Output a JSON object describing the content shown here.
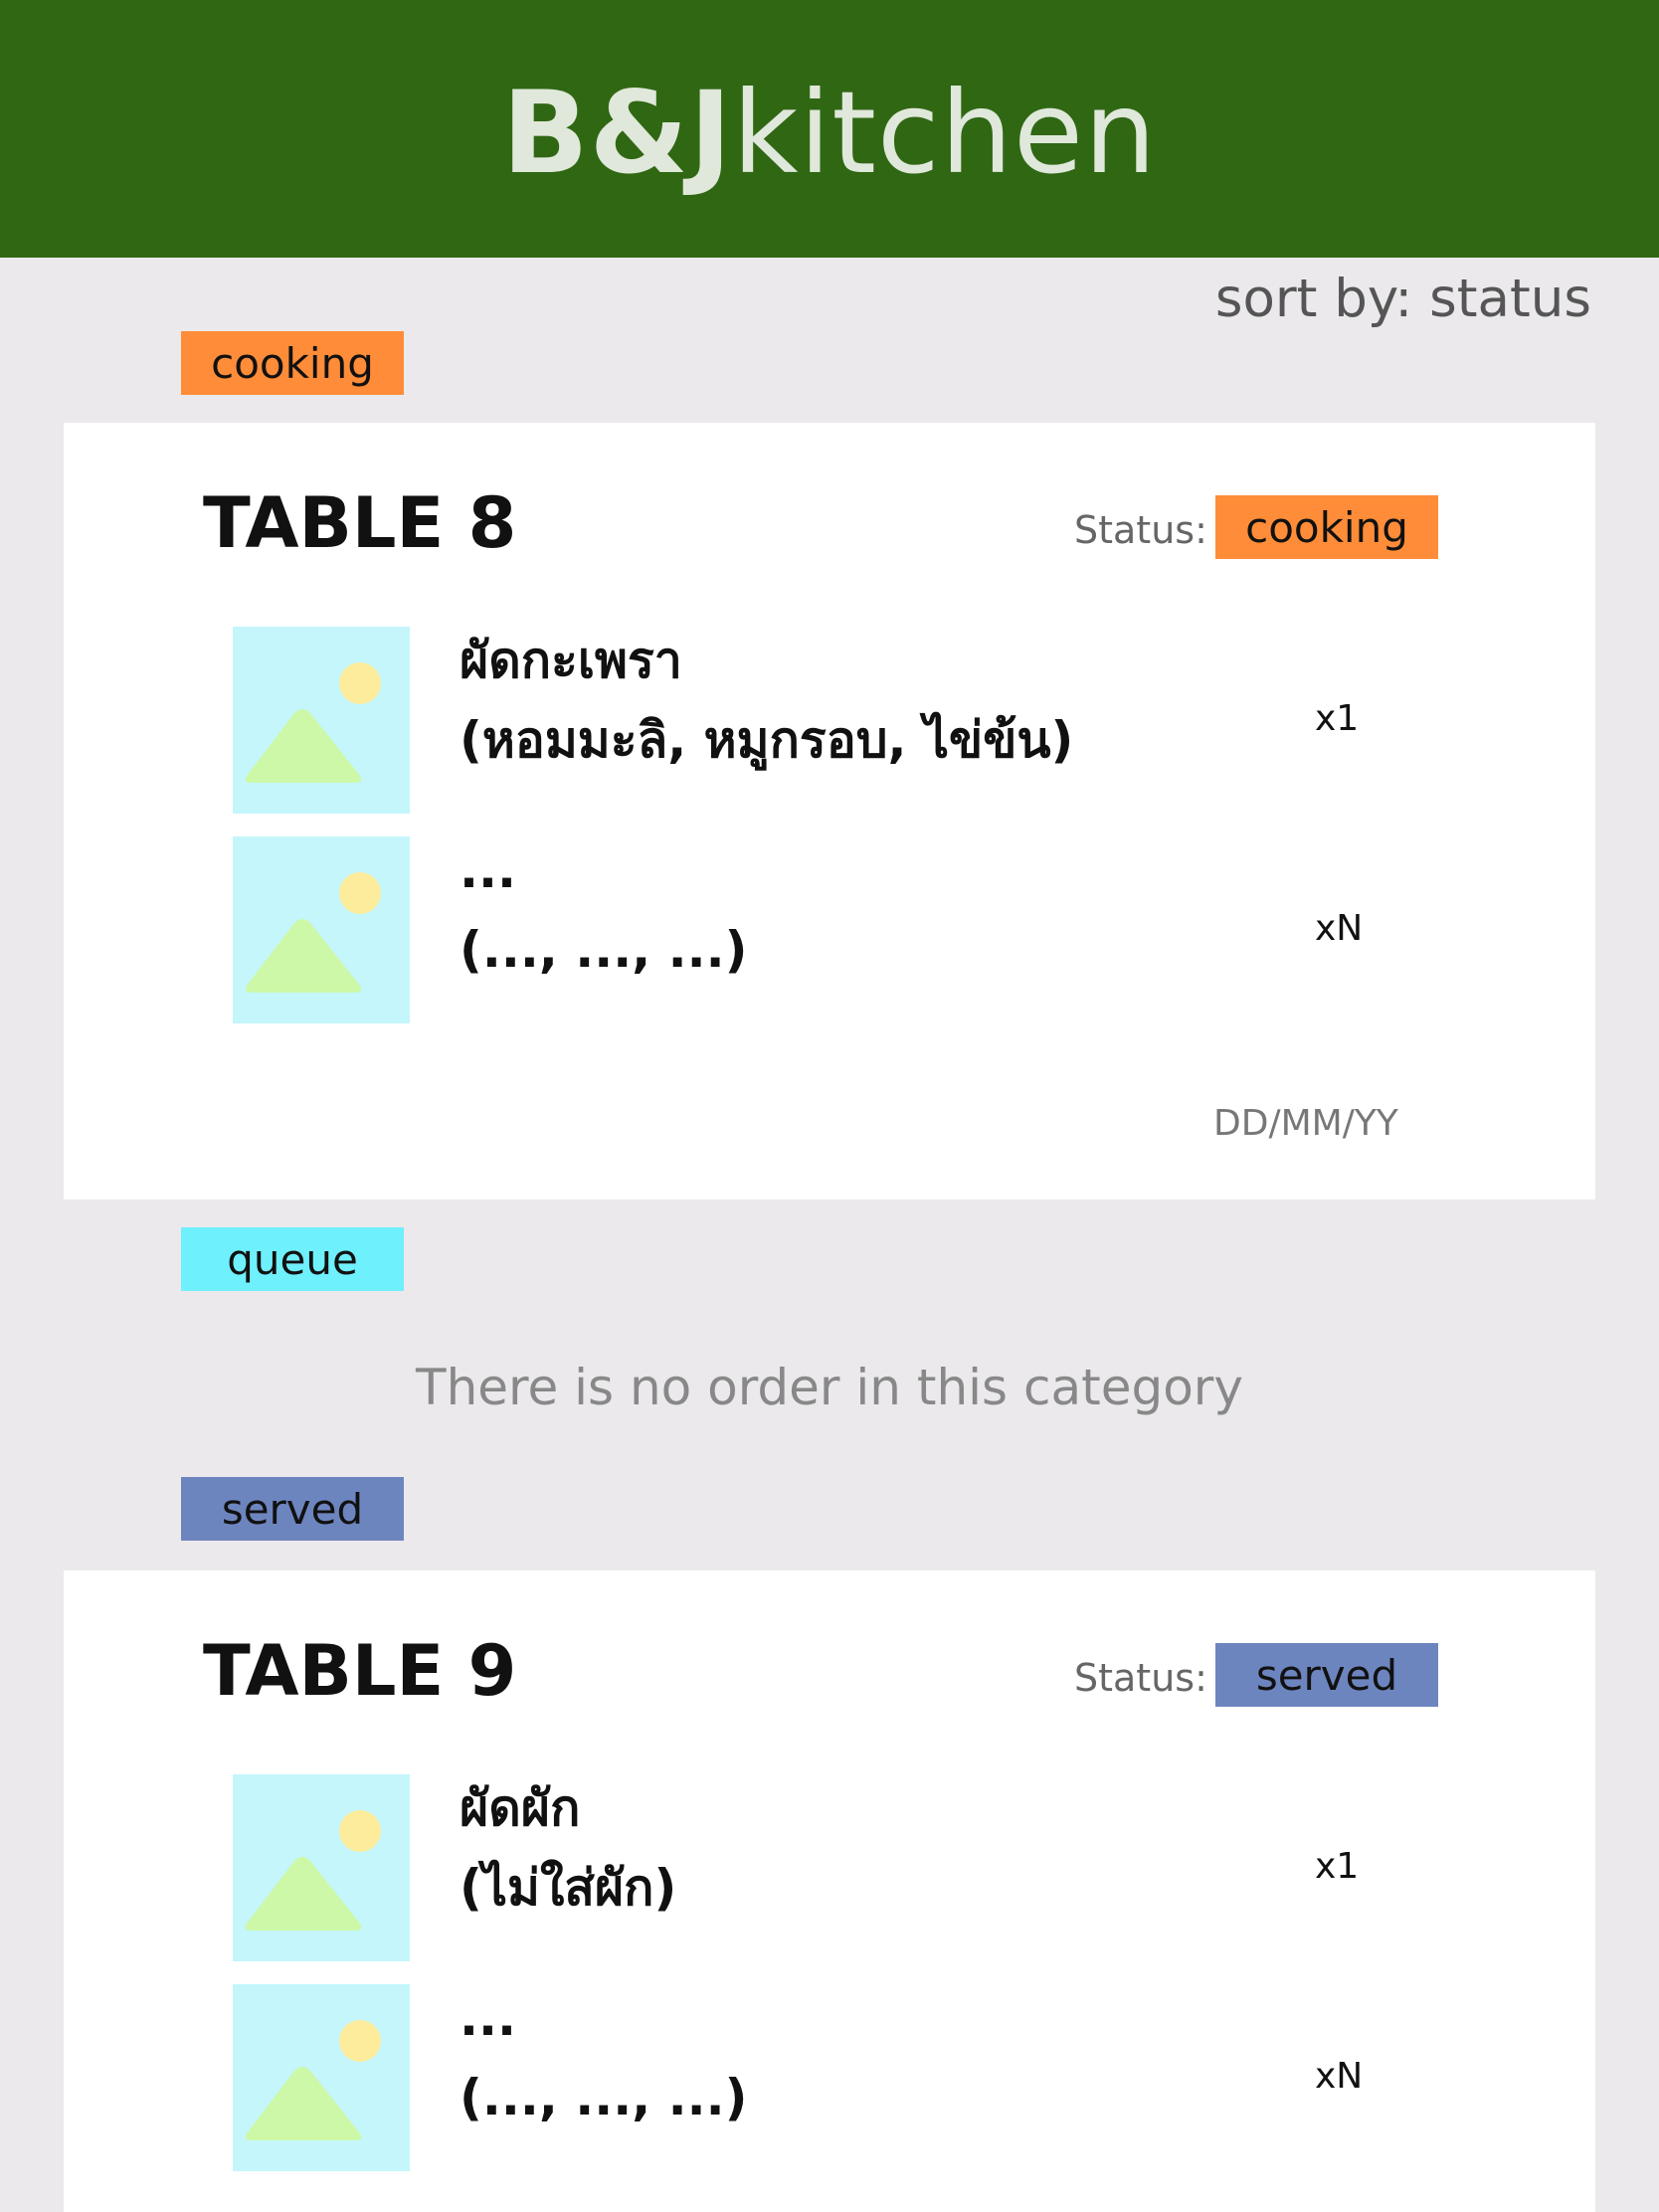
{
  "app": {
    "brand_bold": "B&J",
    "brand_light": "kitchen"
  },
  "sort": {
    "label": "sort by: status"
  },
  "colors": {
    "header_bg": "#306713",
    "cooking": "#ff8c38",
    "queue": "#6ff0fd",
    "served": "#6d85bf"
  },
  "sections": [
    {
      "tag": "cooking",
      "empty_message": "",
      "orders": [
        {
          "table": "TABLE 8",
          "status_label": "Status:",
          "status": "cooking",
          "date": "DD/MM/YY",
          "items": [
            {
              "name": "ผัดกะเพรา",
              "options": "(หอมมะลิ, หมูกรอบ, ไข่ข้น)",
              "qty": "x1",
              "image_icon": "image-placeholder-icon"
            },
            {
              "name": "...",
              "options": "(..., ..., ...)",
              "qty": "xN",
              "image_icon": "image-placeholder-icon"
            }
          ]
        }
      ]
    },
    {
      "tag": "queue",
      "empty_message": "There is no order in this category",
      "orders": []
    },
    {
      "tag": "served",
      "empty_message": "",
      "orders": [
        {
          "table": "TABLE 9",
          "status_label": "Status:",
          "status": "served",
          "date": "",
          "items": [
            {
              "name": "ผัดผัก",
              "options": "(ไม่ใส่ผัก)",
              "qty": "x1",
              "image_icon": "image-placeholder-icon"
            },
            {
              "name": "...",
              "options": "(..., ..., ...)",
              "qty": "xN",
              "image_icon": "image-placeholder-icon"
            }
          ]
        }
      ]
    }
  ]
}
